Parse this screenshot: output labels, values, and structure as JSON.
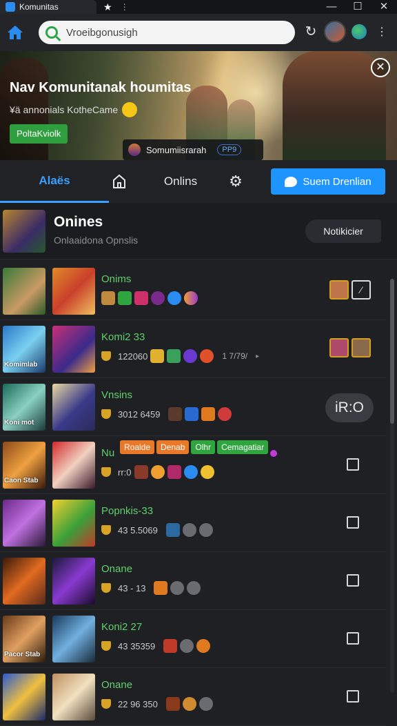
{
  "window": {
    "title": "Komunitas"
  },
  "toolbar": {
    "search_value": "Vroeibgonusigh"
  },
  "banner": {
    "title": "Nav Komunitanak houmitas",
    "subtitle": "¥ä annonials KotheCame",
    "button_label": "PoltaKviolk",
    "chip_label": "Somumiisrarah",
    "chip_badge": "PP9"
  },
  "tabs": [
    {
      "label": "Alaës",
      "active": true
    },
    {
      "label": "Onlins",
      "active": false
    }
  ],
  "send_button": {
    "label": "Suem Drenlian"
  },
  "list_header": {
    "title": "Onines",
    "subtitle": "Onlaaidona Opnslis",
    "notify_label": "Notikicier"
  },
  "rows": [
    {
      "name": "Onims",
      "value": "",
      "thumb_a_caption": "",
      "control": "edit"
    },
    {
      "name": "Komi2 33",
      "value": "122060",
      "extra": "1 7/79/",
      "thumb_a_caption": "Komimlab",
      "control": "faces"
    },
    {
      "name": "Vnsins",
      "value": "3012 6459",
      "thumb_a_caption": "Koni mot",
      "control": "pill",
      "pill_label": "iR:O"
    },
    {
      "name": "Nu",
      "value": "rr:0",
      "thumb_a_caption": "Caon Stab",
      "control": "checkbox",
      "tags": [
        {
          "label": "Roalde",
          "color": "#e8782a"
        },
        {
          "label": "Denab",
          "color": "#e8782a"
        },
        {
          "label": "Olhr",
          "color": "#2fa43f"
        },
        {
          "label": "Cemagatiar",
          "color": "#2fa43f"
        }
      ]
    },
    {
      "name": "Popnkis-33",
      "value": "43 5.5069",
      "thumb_a_caption": "",
      "control": "checkbox"
    },
    {
      "name": "Onane",
      "value": "43 - 13",
      "thumb_a_caption": "",
      "control": "checkbox"
    },
    {
      "name": "Koni2 27",
      "value": "43 35359",
      "thumb_a_caption": "Pacor Stab",
      "control": "checkbox"
    },
    {
      "name": "Onane",
      "value": "22 96 350",
      "thumb_a_caption": "",
      "control": "checkbox"
    }
  ],
  "colors": {
    "accent": "#1e94ff",
    "online_green": "#5fd16a",
    "bg": "#1e2024"
  }
}
